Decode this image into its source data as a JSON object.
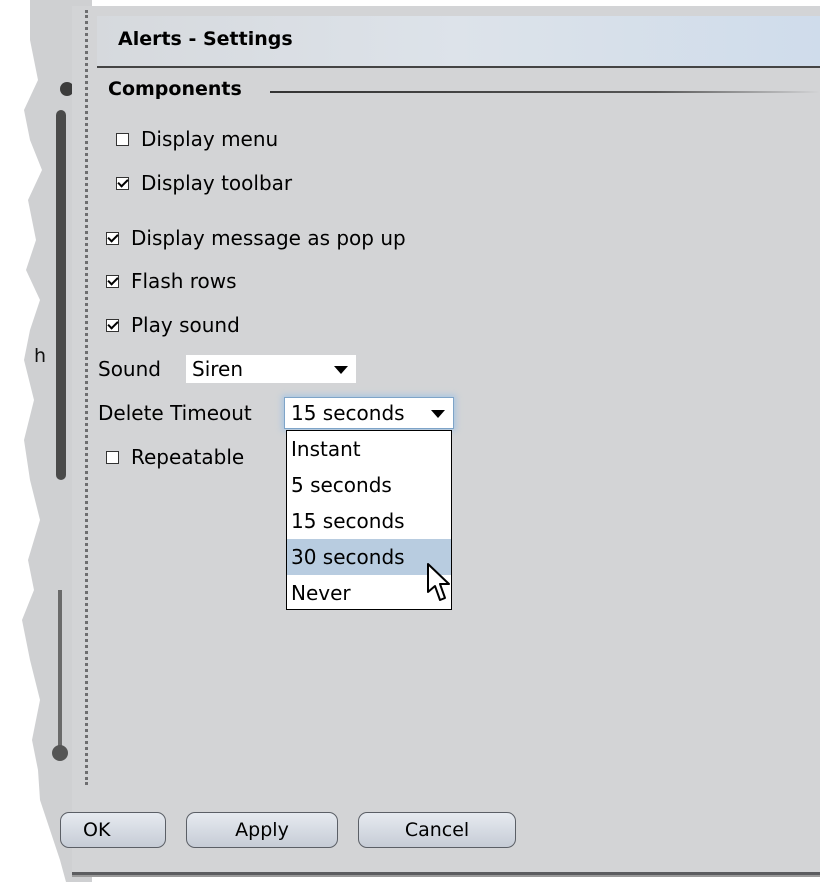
{
  "window": {
    "title": "Alerts - Settings"
  },
  "background_fragment": {
    "letter": "h"
  },
  "components": {
    "heading": "Components",
    "display_menu": {
      "label": "Display menu",
      "checked": false
    },
    "display_toolbar": {
      "label": "Display toolbar",
      "checked": true
    }
  },
  "options": {
    "popup": {
      "label": "Display message as pop up",
      "checked": true
    },
    "flash_rows": {
      "label": "Flash rows",
      "checked": true
    },
    "play_sound": {
      "label": "Play sound",
      "checked": true
    },
    "repeatable": {
      "label": "Repeatable",
      "checked": false
    }
  },
  "sound": {
    "label": "Sound",
    "value": "Siren"
  },
  "delete_timeout": {
    "label": "Delete Timeout",
    "value": "15 seconds",
    "options": [
      "Instant",
      "5 seconds",
      "15 seconds",
      "30 seconds",
      "Never"
    ],
    "highlighted": "30 seconds"
  },
  "buttons": {
    "ok": "OK",
    "apply": "Apply",
    "cancel": "Cancel"
  },
  "colors": {
    "panel": "#d3d4d6",
    "highlight": "#b8cce0",
    "focus_glow": "#a9c6e2"
  }
}
